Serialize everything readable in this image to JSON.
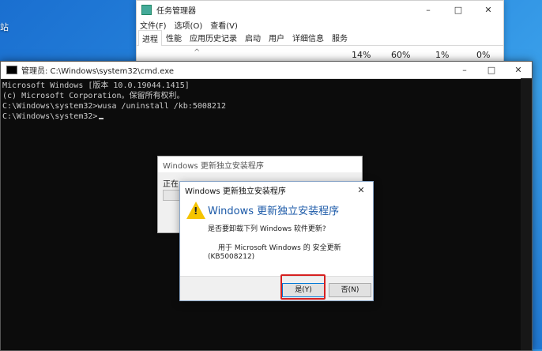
{
  "desktop": {
    "label": "站"
  },
  "task_manager": {
    "title": "任务管理器",
    "controls": [
      "–",
      "□",
      "✕"
    ],
    "menu": [
      "文件(F)",
      "选项(O)",
      "查看(V)"
    ],
    "tabs": [
      "进程",
      "性能",
      "应用历史记录",
      "启动",
      "用户",
      "详细信息",
      "服务"
    ],
    "active_tab": "进程",
    "stats": [
      "14%",
      "60%",
      "1%",
      "0%"
    ]
  },
  "cmd": {
    "title": "管理员: C:\\Windows\\system32\\cmd.exe",
    "controls": [
      "–",
      "□",
      "✕"
    ],
    "lines": [
      "Microsoft Windows [版本 10.0.19044.1415]",
      "(c) Microsoft Corporation。保留所有权利。",
      "",
      "C:\\Windows\\system32>wusa /uninstall /kb:5008212",
      "",
      "C:\\Windows\\system32>"
    ]
  },
  "bg_dialog": {
    "title": "Windows 更新独立安装程序",
    "text": "正在"
  },
  "dialog": {
    "title": "Windows 更新独立安装程序",
    "heading": "Windows 更新独立安装程序",
    "question": "是否要卸载下列 Windows 软件更新?",
    "detail_line1": "用于 Microsoft Windows 的 安全更新",
    "detail_line2": "(KB5008212)",
    "yes_label": "是(Y)",
    "no_label": "否(N)",
    "close": "✕"
  },
  "colors": {
    "highlight": "#d62020",
    "heading": "#1c5aa8",
    "console_bg": "#0c0c0c"
  }
}
